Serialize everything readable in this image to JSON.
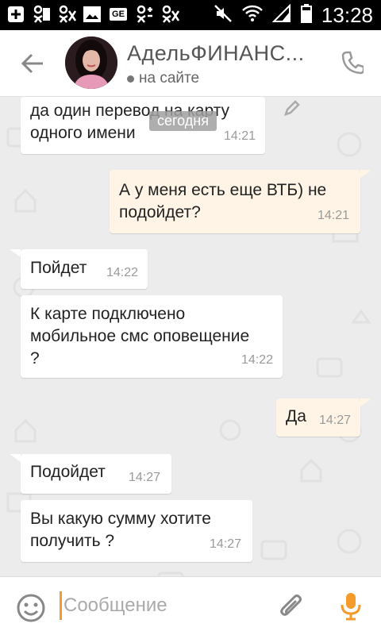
{
  "status_bar": {
    "time": "13:28",
    "left_icons": [
      "add-icon",
      "ok-icon",
      "ok-icon",
      "image-icon",
      "ge-icon",
      "ok-icon",
      "ok-icon"
    ],
    "ge_label": "GE"
  },
  "header": {
    "title": "АдельФИНАНС...",
    "status": "на сайте"
  },
  "chat": {
    "date_chip": "сегодня",
    "messages": [
      {
        "dir": "in",
        "text1": "да один перевод на карту",
        "text2": "одного имени",
        "time": "14:21"
      },
      {
        "dir": "out",
        "text1": "А у меня есть еще ВТБ) не",
        "text2": "подойдет?",
        "time": "14:21"
      },
      {
        "dir": "in",
        "text1": "Пойдет",
        "time": "14:22"
      },
      {
        "dir": "in",
        "text1": "К карте подключено",
        "text2": "мобильное смс оповещение",
        "text3": "?",
        "time": "14:22"
      },
      {
        "dir": "out",
        "text1": "Да",
        "time": "14:27"
      },
      {
        "dir": "in",
        "text1": "Подойдет",
        "time": "14:27"
      },
      {
        "dir": "in",
        "text1": "Вы какую сумму хотите",
        "text2": "получить  ?",
        "time": "14:27"
      }
    ]
  },
  "input": {
    "placeholder": "Сообщение"
  },
  "colors": {
    "accent": "#f59b2c",
    "out_bubble": "#fff4e6",
    "chat_bg": "#ececec"
  }
}
